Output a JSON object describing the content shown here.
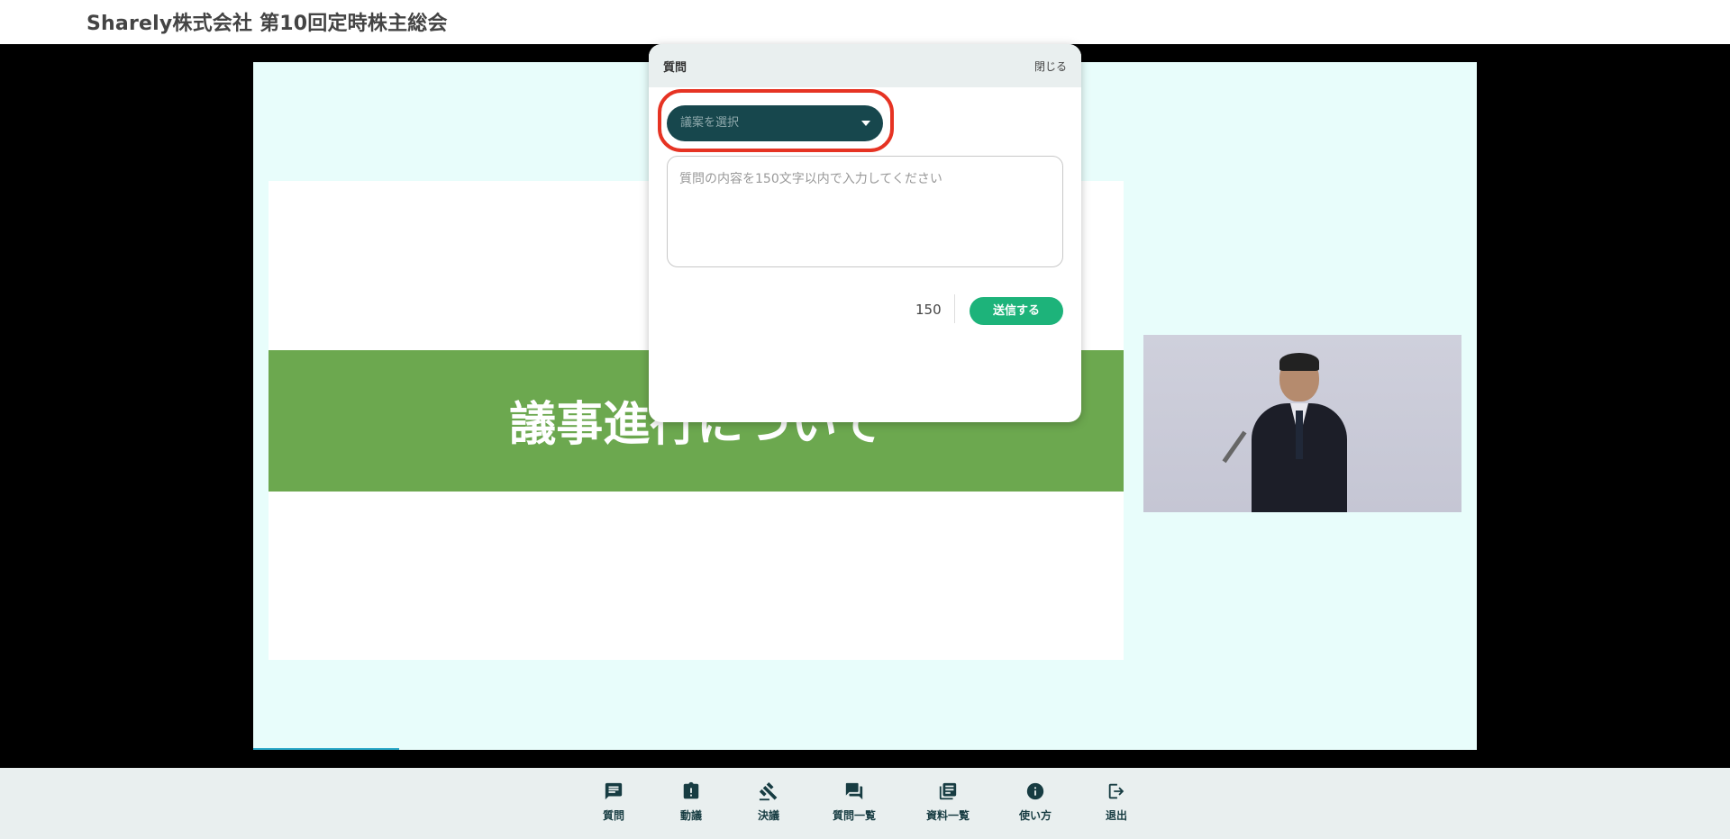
{
  "header": {
    "title": "Sharely株式会社 第10回定時株主総会"
  },
  "slide": {
    "heading": "議事進行について"
  },
  "modal": {
    "title": "質問",
    "close_label": "閉じる",
    "select_placeholder": "議案を選択",
    "textarea_placeholder": "質問の内容を150文字以内で入力してください",
    "char_counter": "150",
    "send_label": "送信する"
  },
  "footer": {
    "items": [
      {
        "label": "質問",
        "icon": "chat-note-icon"
      },
      {
        "label": "動議",
        "icon": "clipboard-alert-icon"
      },
      {
        "label": "決議",
        "icon": "gavel-icon"
      },
      {
        "label": "質問一覧",
        "icon": "forum-icon"
      },
      {
        "label": "資料一覧",
        "icon": "library-books-icon"
      },
      {
        "label": "使い方",
        "icon": "info-icon"
      },
      {
        "label": "退出",
        "icon": "logout-icon"
      }
    ]
  },
  "colors": {
    "accent_dark": "#17474d",
    "send_green": "#1db37a",
    "highlight_red": "#e63323",
    "slide_band": "#6ca84f"
  }
}
